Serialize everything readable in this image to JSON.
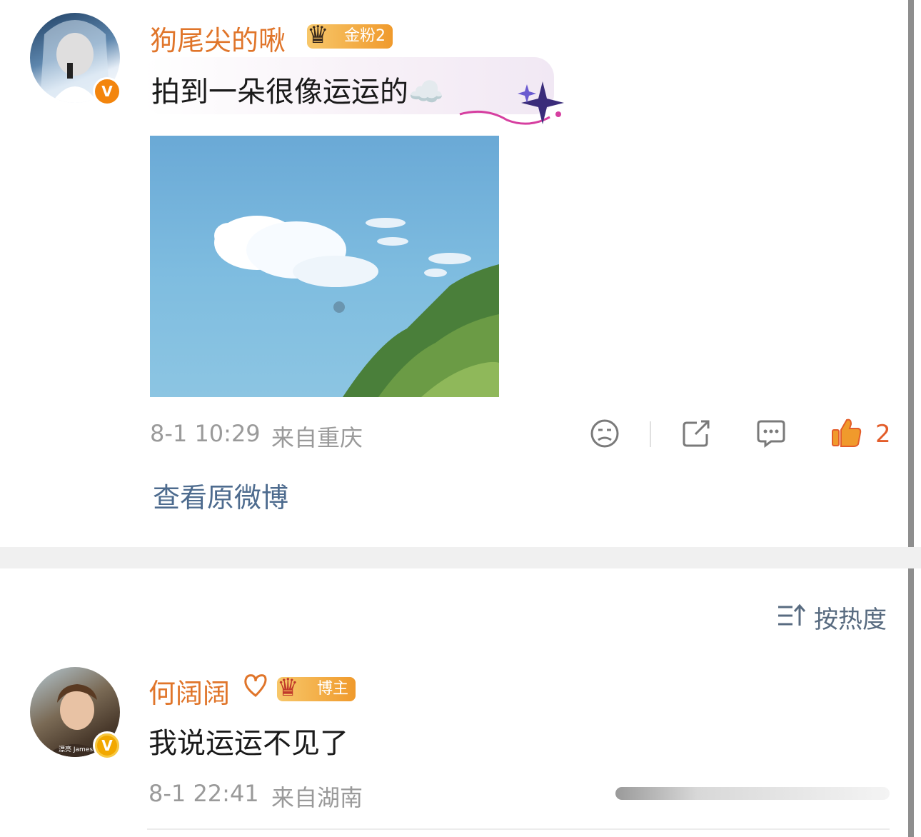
{
  "post": {
    "username": "狗尾尖的啾",
    "fan_badge": "金粉2",
    "verified_badge": "V",
    "content": "拍到一朵很像运运的☁️",
    "timestamp": "8-1 10:29",
    "location": "来自重庆",
    "like_count": "2",
    "view_original": "查看原微博"
  },
  "sort": {
    "label": "按热度"
  },
  "comment": {
    "username": "何阔阔",
    "badge": "博主",
    "verified_badge": "V",
    "content": "我说运运不见了",
    "timestamp": "8-1 22:41",
    "location": "来自湖南",
    "avatar_caption": "漂亮 James"
  }
}
